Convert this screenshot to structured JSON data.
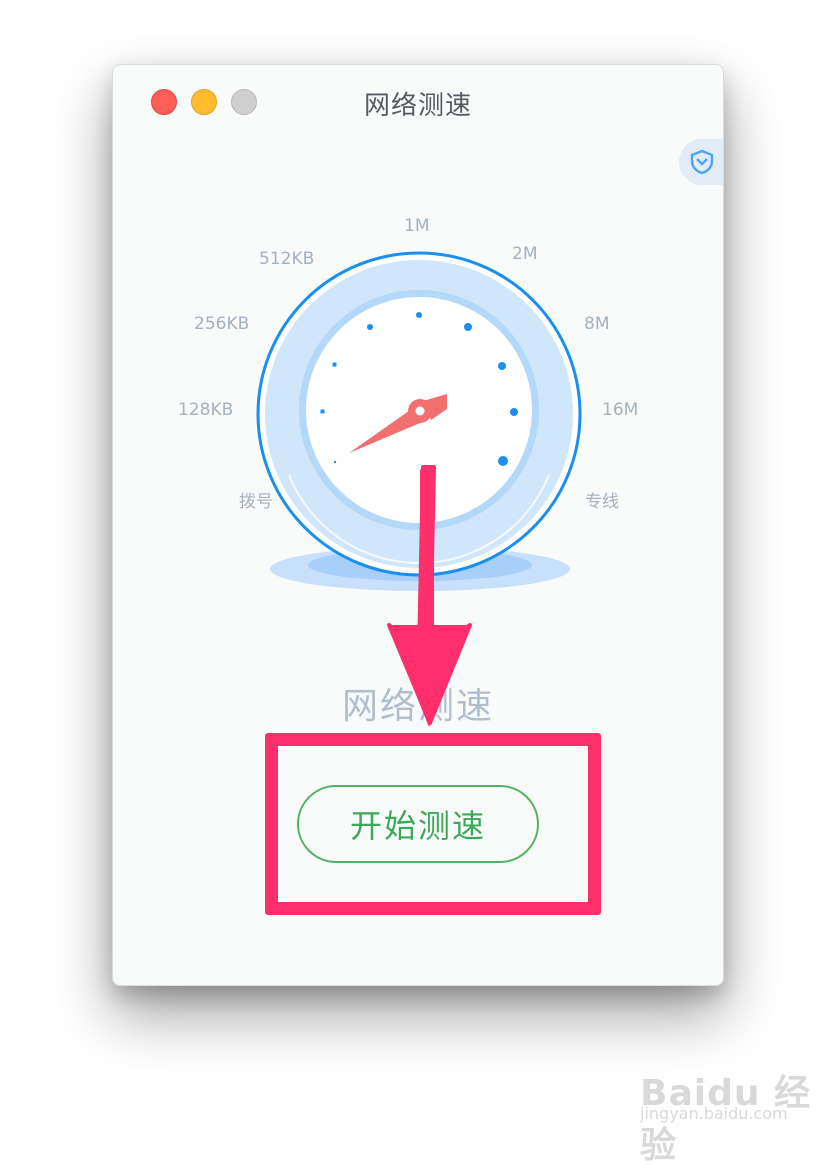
{
  "window": {
    "title": "网络测速"
  },
  "gauge": {
    "scale_labels": [
      "拨号",
      "128KB",
      "256KB",
      "512KB",
      "1M",
      "2M",
      "8M",
      "16M",
      "专线"
    ],
    "needle_color": "#f26f6f",
    "ring_color": "#1a8ff0"
  },
  "main": {
    "caption": "网络测速",
    "start_button_label": "开始测速"
  },
  "annotation": {
    "highlight_color": "#fe2f6c"
  },
  "watermark": {
    "brand": "Baidu 经验",
    "url": "jingyan.baidu.com"
  }
}
